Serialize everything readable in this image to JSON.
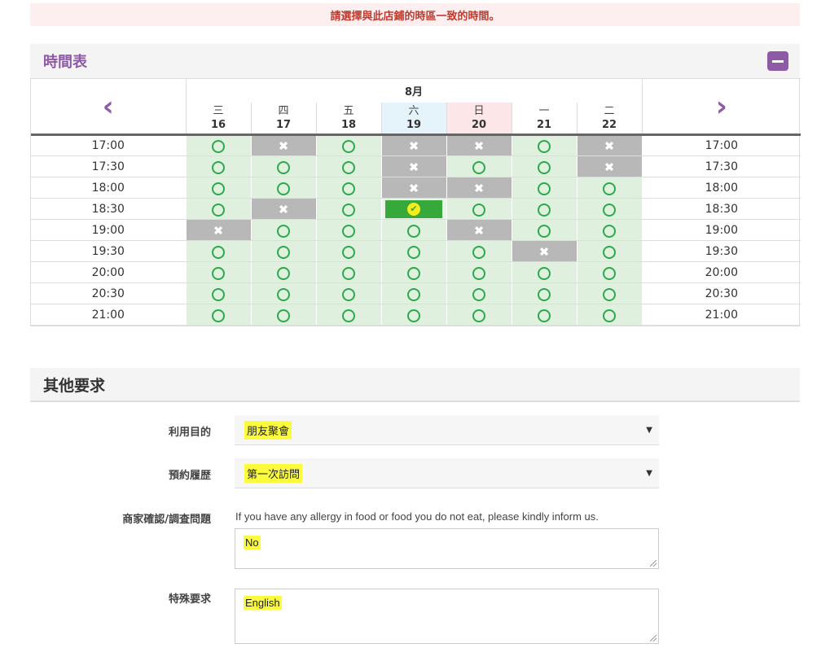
{
  "notice": "請選擇與此店鋪的時區一致的時間。",
  "timetable": {
    "title": "時間表",
    "month": "8月",
    "days": [
      {
        "weekday": "三",
        "date": "16",
        "type": "weekday"
      },
      {
        "weekday": "四",
        "date": "17",
        "type": "weekday"
      },
      {
        "weekday": "五",
        "date": "18",
        "type": "weekday"
      },
      {
        "weekday": "六",
        "date": "19",
        "type": "saturday"
      },
      {
        "weekday": "日",
        "date": "20",
        "type": "sunday"
      },
      {
        "weekday": "一",
        "date": "21",
        "type": "weekday"
      },
      {
        "weekday": "二",
        "date": "22",
        "type": "weekday"
      }
    ],
    "rows": [
      {
        "time": "17:00",
        "slots": [
          "available",
          "full",
          "available",
          "full",
          "full",
          "available",
          "full"
        ]
      },
      {
        "time": "17:30",
        "slots": [
          "available",
          "available",
          "available",
          "full",
          "available",
          "available",
          "full"
        ]
      },
      {
        "time": "18:00",
        "slots": [
          "available",
          "available",
          "available",
          "full",
          "full",
          "available",
          "available"
        ]
      },
      {
        "time": "18:30",
        "slots": [
          "available",
          "full",
          "available",
          "selected",
          "available",
          "available",
          "available"
        ]
      },
      {
        "time": "19:00",
        "slots": [
          "full",
          "available",
          "available",
          "available",
          "full",
          "available",
          "available"
        ]
      },
      {
        "time": "19:30",
        "slots": [
          "available",
          "available",
          "available",
          "available",
          "available",
          "full",
          "available"
        ]
      },
      {
        "time": "20:00",
        "slots": [
          "available",
          "available",
          "available",
          "available",
          "available",
          "available",
          "available"
        ]
      },
      {
        "time": "20:30",
        "slots": [
          "available",
          "available",
          "available",
          "available",
          "available",
          "available",
          "available"
        ]
      },
      {
        "time": "21:00",
        "slots": [
          "available",
          "available",
          "available",
          "available",
          "available",
          "available",
          "available"
        ]
      }
    ]
  },
  "other": {
    "title": "其他要求",
    "purpose_label": "利用目的",
    "purpose_value": "朋友聚會",
    "history_label": "預約履歴",
    "history_value": "第一次訪問",
    "question_label": "商家確認/調査問題",
    "question_hint": "If you have any allergy in food or food you do not eat, please kindly inform us.",
    "question_value": "No",
    "special_label": "特殊要求",
    "special_value": "English"
  },
  "icons": {
    "prev": "chevron-left-icon",
    "next": "chevron-right-icon",
    "collapse": "minus-icon",
    "available": "circle-icon",
    "full": "cross-icon",
    "selected": "check-icon"
  },
  "colors": {
    "accent": "#8e5aa6",
    "available_bg": "#dff0df",
    "full_bg": "#b8b8b8",
    "selected_bg": "#37a83a",
    "highlight": "#fbfb3e",
    "notice_text": "#c0392b"
  }
}
